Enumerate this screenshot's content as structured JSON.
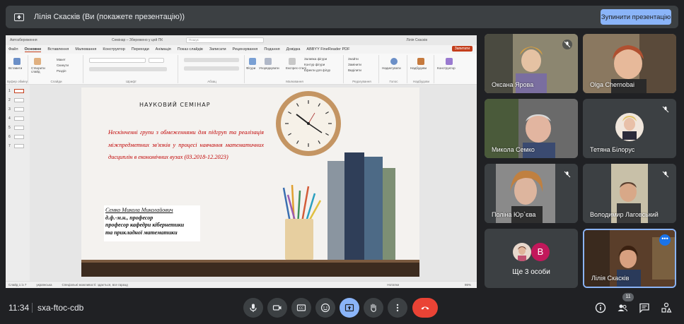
{
  "topbar": {
    "title": "Лілія Скаскiв (Ви (покажете презентацію))",
    "stop_label": "Зупинити презентацію"
  },
  "ppt": {
    "autosave": "Автозбереження",
    "doc_title": "Семінар – Збережено у цей ПК",
    "search_placeholder": "Пошук",
    "user": "Лілія Скаскiв",
    "share_label": "Запитати",
    "tabs": [
      "Файл",
      "Основне",
      "Вставлення",
      "Малювання",
      "Конструктор",
      "Переходи",
      "Анімація",
      "Показ слайдів",
      "Записати",
      "Рецензування",
      "Подання",
      "Довідка",
      "ABBYY FineReader PDF"
    ],
    "ribbon_groups": [
      "Буфер обміну",
      "Слайди",
      "Шрифт",
      "Абзац",
      "Малювання",
      "Редагування",
      "Голос",
      "Надбудови"
    ],
    "ribbon_items": {
      "paste": "Вставити",
      "new_slide": "Створити слайд",
      "layout": "Макет",
      "reset": "Скинути",
      "section": "Розділ",
      "shapes": "Фігури",
      "arrange": "Упорядкувати",
      "quick_styles": "Експрес-стилі",
      "fill": "Заливка фігури",
      "outline": "Контур фігури",
      "effects": "Ефекти для фігур",
      "find": "Знайти",
      "replace": "Замінити",
      "select": "Виділити",
      "dictate": "Надиктувати",
      "addins": "Надбудови",
      "designer": "Конструктор"
    },
    "slide_numbers": [
      "1",
      "2",
      "3",
      "4",
      "5",
      "6",
      "7"
    ],
    "status": {
      "slide": "Слайд 1 із 7",
      "lang": "українська",
      "accessibility": "Спеціальні можливості: здається, все гаразд",
      "notes": "Нотатки",
      "zoom": "86%"
    }
  },
  "slide": {
    "heading": "НАУКОВИЙ СЕМІНАР",
    "topic": "Нескінченні групи з обмеженнями для підгруп та реалізація міжпредметних зв'язків у процесі навчання математичних дисциплін в економічних вузах (03.2018-12.2023)",
    "author_name": "Семко Микола Миколайович",
    "author_degree": "д.ф.-м.н., професор",
    "author_pos1": "професор кафедри кібернетики",
    "author_pos2": "та прикладної математики"
  },
  "participants": [
    {
      "name": "Оксана Ярова",
      "muted": true
    },
    {
      "name": "Olga Chernobai",
      "muted": false
    },
    {
      "name": "Микола Семко",
      "muted": false
    },
    {
      "name": "Тетяна Білорус",
      "muted": true
    },
    {
      "name": "Поліна Юр`єва",
      "muted": true
    },
    {
      "name": "Володимир Лаговський",
      "muted": true
    },
    {
      "name": "Ще 3 особи",
      "avatar_letter": "B"
    },
    {
      "name": "Лілія Скаскiв"
    }
  ],
  "bottom": {
    "time": "11:34",
    "meeting_code": "sxa-ftoc-cdb",
    "people_count": "11"
  },
  "colors": {
    "accent": "#8ab4f8",
    "leave": "#ea4335",
    "bg": "#202124",
    "tile": "#3c4043",
    "slide_red": "#c00000"
  }
}
